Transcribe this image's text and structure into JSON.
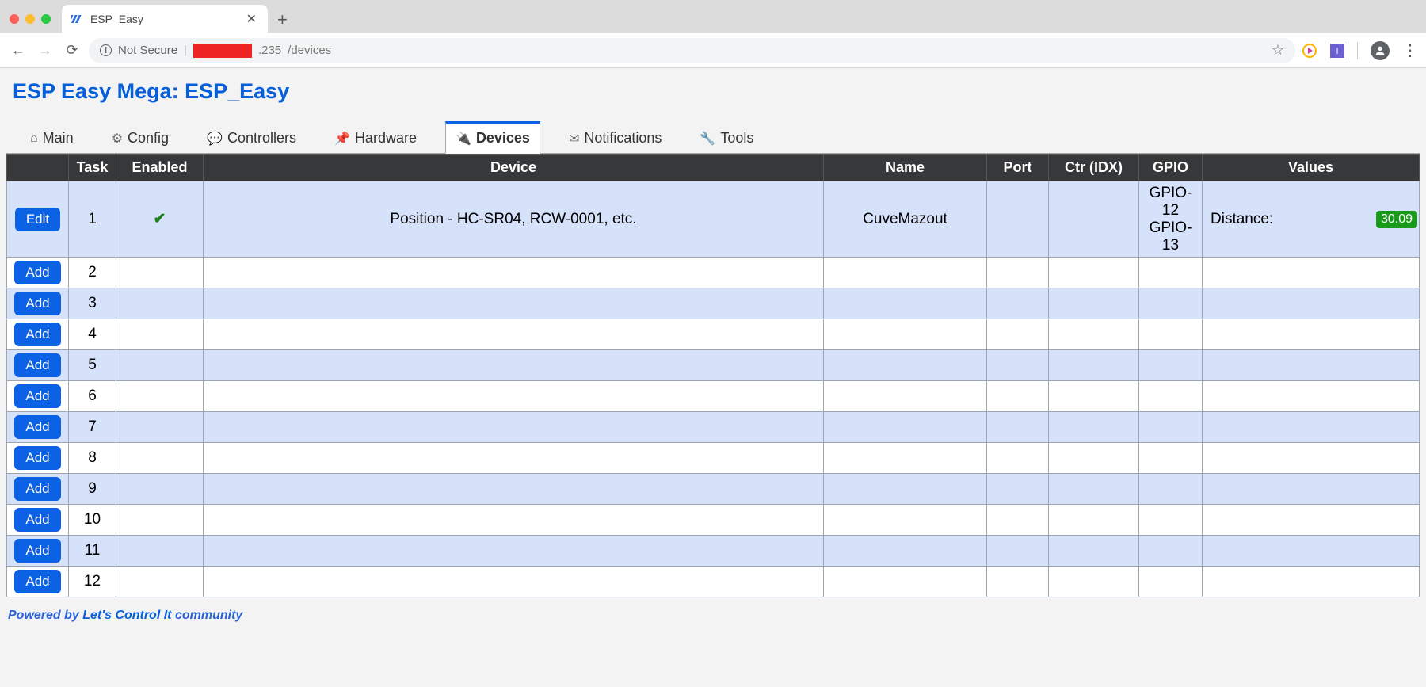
{
  "browser": {
    "tab_title": "ESP_Easy",
    "url_not_secure": "Not Secure",
    "url_host_suffix": ".235",
    "url_path": "/devices"
  },
  "page": {
    "title": "ESP Easy Mega: ESP_Easy",
    "tabs": {
      "main": "Main",
      "config": "Config",
      "controllers": "Controllers",
      "hardware": "Hardware",
      "devices": "Devices",
      "notifications": "Notifications",
      "tools": "Tools"
    },
    "table": {
      "headers": {
        "action": "",
        "task": "Task",
        "enabled": "Enabled",
        "device": "Device",
        "name": "Name",
        "port": "Port",
        "ctr": "Ctr (IDX)",
        "gpio": "GPIO",
        "values": "Values"
      },
      "edit_label": "Edit",
      "add_label": "Add",
      "rows": [
        {
          "action": "edit",
          "task": "1",
          "enabled": "✔",
          "device": "Position - HC-SR04, RCW-0001, etc.",
          "name": "CuveMazout",
          "port": "",
          "ctr": "",
          "gpio": "GPIO-12\nGPIO-13",
          "value_label": "Distance:",
          "value_badge": "30.09"
        },
        {
          "action": "add",
          "task": "2"
        },
        {
          "action": "add",
          "task": "3"
        },
        {
          "action": "add",
          "task": "4"
        },
        {
          "action": "add",
          "task": "5"
        },
        {
          "action": "add",
          "task": "6"
        },
        {
          "action": "add",
          "task": "7"
        },
        {
          "action": "add",
          "task": "8"
        },
        {
          "action": "add",
          "task": "9"
        },
        {
          "action": "add",
          "task": "10"
        },
        {
          "action": "add",
          "task": "11"
        },
        {
          "action": "add",
          "task": "12"
        }
      ]
    },
    "footer": {
      "powered": "Powered by ",
      "link": "Let's Control It",
      "community": " community"
    }
  }
}
